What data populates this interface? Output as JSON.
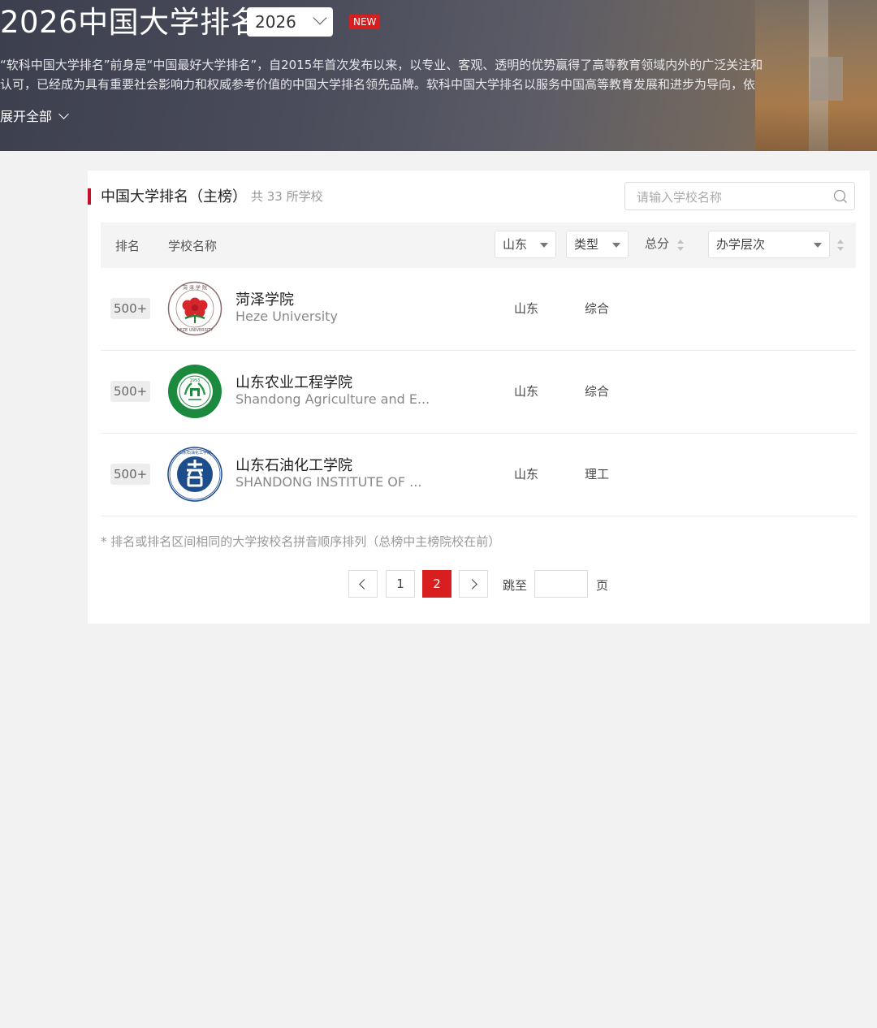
{
  "banner": {
    "title": "2026中国大学排名",
    "year_selected": "2026",
    "new_badge": "NEW",
    "intro_line1": "“软科中国大学排名”前身是“中国最好大学排名”，自2015年首次发布以来，以专业、客观、透明的优势赢得了高等教育领域内外的广泛关注和",
    "intro_line2": "认可，已经成为具有重要社会影响力和权威参考价值的中国大学排名领先品牌。软科中国大学排名以服务中国高等教育发展和进步为导向，依",
    "expand_label": "展开全部"
  },
  "card": {
    "title": "中国大学排名（主榜）",
    "count": "共 33 所学校",
    "search_placeholder": "请输入学校名称"
  },
  "table": {
    "headers": {
      "rank": "排名",
      "name": "学校名称",
      "province_filter": "山东",
      "type_filter": "类型",
      "score": "总分",
      "level_filter": "办学层次"
    },
    "rows": [
      {
        "rank": "500+",
        "name": "菏泽学院",
        "name_en": "Heze University",
        "province": "山东",
        "type": "综合",
        "logo": "heze-logo"
      },
      {
        "rank": "500+",
        "name": "山东农业工程学院",
        "name_en": "Shandong Agriculture and E...",
        "province": "山东",
        "type": "综合",
        "logo": "sdae-logo"
      },
      {
        "rank": "500+",
        "name": "山东石油化工学院",
        "name_en": "SHANDONG INSTITUTE OF ...",
        "province": "山东",
        "type": "理工",
        "logo": "sipt-logo"
      }
    ],
    "footnote": "* 排名或排名区间相同的大学按校名拼音顺序排列（总榜中主榜院校在前）"
  },
  "pagination": {
    "pages": [
      "1",
      "2"
    ],
    "current": "2",
    "jump_label": "跳至",
    "page_suffix": "页"
  },
  "colors": {
    "accent": "#d81e1e",
    "title_bar": "#c8102e",
    "background": "#f2f2f2"
  }
}
